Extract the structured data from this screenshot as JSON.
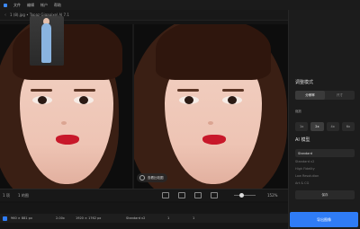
{
  "menu": {
    "items": [
      "文件",
      "编辑",
      "帐户",
      "帮助"
    ]
  },
  "titlebar": {
    "title": "1 (8).jpg • Topaz Gigapixel AI 7.1"
  },
  "compare_badge": "查看比较图",
  "sidebar": {
    "mode_title": "调整模式",
    "mode_tabs": [
      "分辨率",
      "尺寸"
    ],
    "scale_label": "缩放",
    "scale_options": [
      "1x",
      "2x",
      "4x",
      "6x"
    ],
    "scale_active": "2x",
    "ai_model_title": "AI 模型",
    "model_selected": "Standard",
    "model_list": [
      {
        "name": "Standard v2",
        "tag": ""
      },
      {
        "name": "High Fidelity",
        "tag": ""
      },
      {
        "name": "Low Resolution",
        "tag": ""
      },
      {
        "name": "Art & CG",
        "tag": ""
      },
      {
        "name": "Redefine",
        "tag": "新"
      }
    ],
    "save_label": "保存",
    "export_label": "导出图像"
  },
  "toolbar": {
    "left_label": "1 项",
    "count_label": "1 的图",
    "zoom": "152%"
  },
  "file_row": {
    "input_size": "960 × 881 px",
    "scale": "2.00x",
    "output_size": "1920 × 1762 px",
    "model": "Standard v2",
    "c1": "1",
    "c2": "1"
  },
  "colors": {
    "accent": "#2f7cf6",
    "panel": "#1c1c1c",
    "canvas": "#0d0d0d"
  }
}
